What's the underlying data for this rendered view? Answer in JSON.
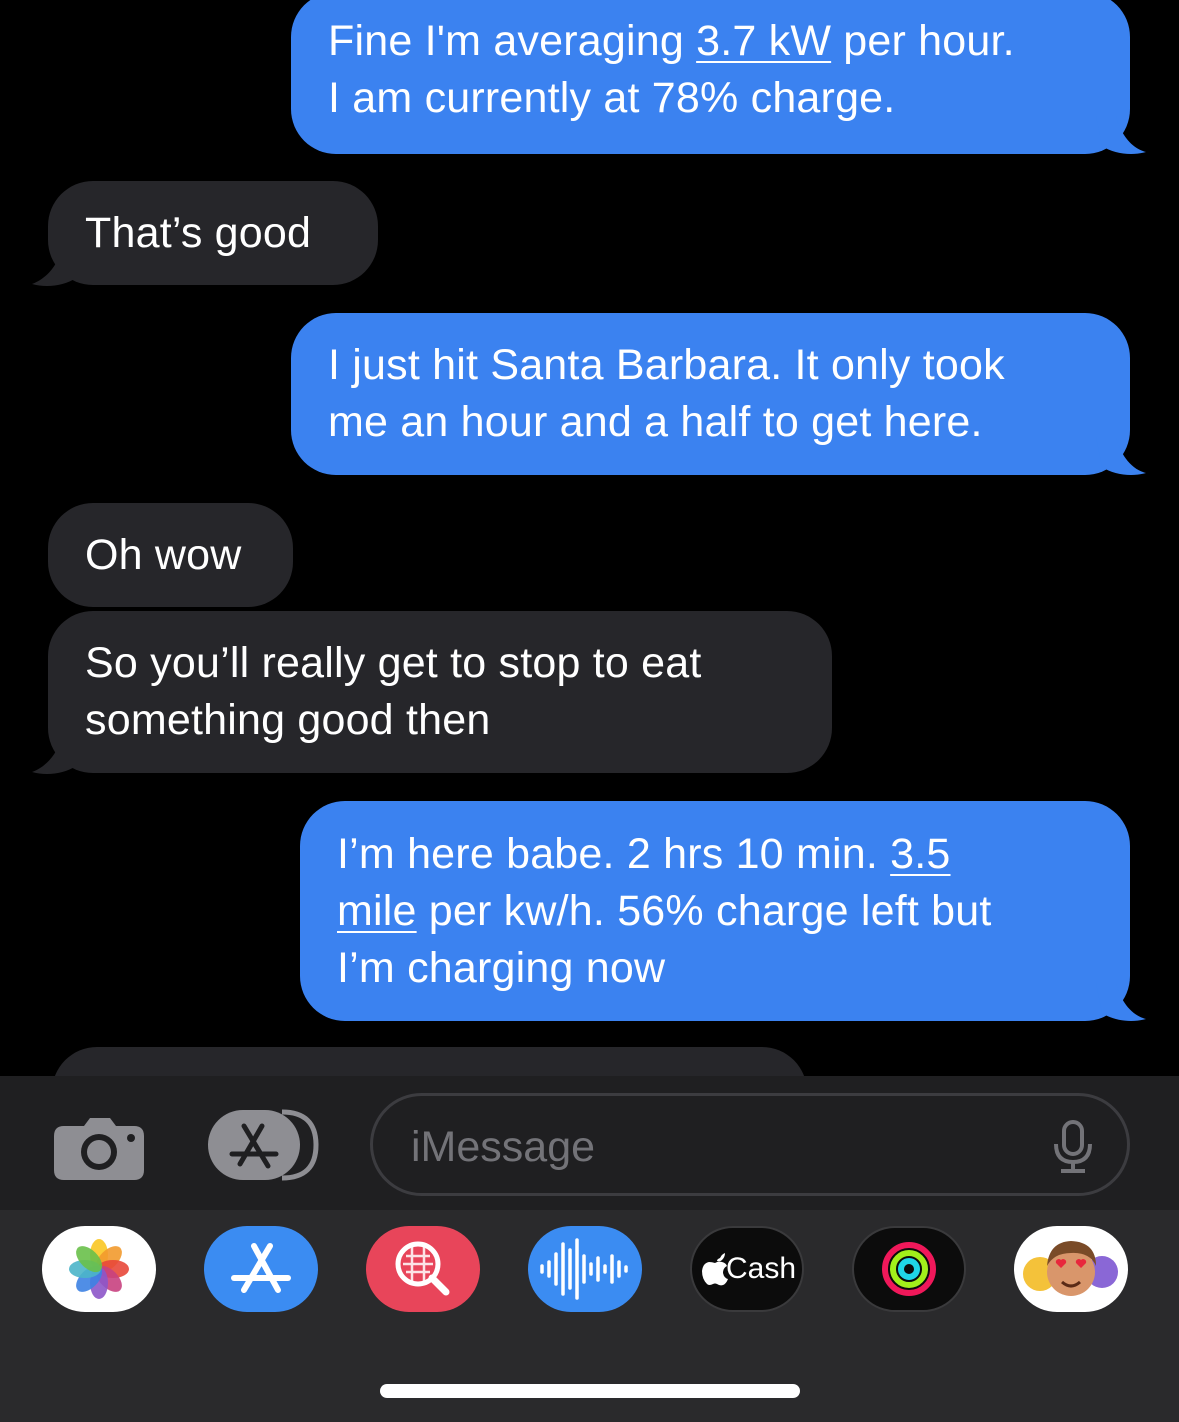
{
  "messages": [
    {
      "dir": "sent",
      "lines": [
        [
          {
            "t": "Fine I'm averaging "
          },
          {
            "t": "3.7 kW",
            "u": true
          },
          {
            "t": " per hour."
          }
        ],
        [
          {
            "t": "I am currently at 78% charge."
          }
        ]
      ]
    },
    {
      "dir": "recv",
      "lines": [
        [
          {
            "t": "That’s good"
          }
        ]
      ]
    },
    {
      "dir": "sent",
      "lines": [
        [
          {
            "t": "I just hit Santa Barbara. It only took"
          }
        ],
        [
          {
            "t": "me an hour and a half to get here."
          }
        ]
      ]
    },
    {
      "dir": "recv",
      "lines": [
        [
          {
            "t": "Oh wow"
          }
        ]
      ]
    },
    {
      "dir": "recv",
      "lines": [
        [
          {
            "t": "So you’ll really get to stop to eat"
          }
        ],
        [
          {
            "t": "something good then"
          }
        ]
      ]
    },
    {
      "dir": "sent",
      "lines": [
        [
          {
            "t": "I’m here babe. 2 hrs 10 min. "
          },
          {
            "t": "3.5",
            "u": true
          }
        ],
        [
          {
            "t": "mile",
            "u": true
          },
          {
            "t": " per kw/h. 56% charge left but"
          }
        ],
        [
          {
            "t": "I’m charging now"
          }
        ]
      ]
    }
  ],
  "composer": {
    "placeholder": "iMessage",
    "camera_icon": "camera-icon",
    "apps_icon": "app-store-icon",
    "mic_icon": "microphone-icon"
  },
  "app_drawer": [
    {
      "name": "photos",
      "icon": "photos-icon"
    },
    {
      "name": "app-store",
      "icon": "app-store-icon"
    },
    {
      "name": "image-search",
      "icon": "image-search-icon"
    },
    {
      "name": "audio-message",
      "icon": "waveform-icon"
    },
    {
      "name": "apple-cash",
      "icon": "apple-logo-icon",
      "label": "Cash"
    },
    {
      "name": "activity",
      "icon": "activity-rings-icon"
    },
    {
      "name": "memoji",
      "icon": "memoji-icon"
    }
  ],
  "colors": {
    "sent_bubble": "#3b82f0",
    "received_bubble": "#26262a",
    "background": "#000000",
    "drawer": "#2a2a2c"
  }
}
